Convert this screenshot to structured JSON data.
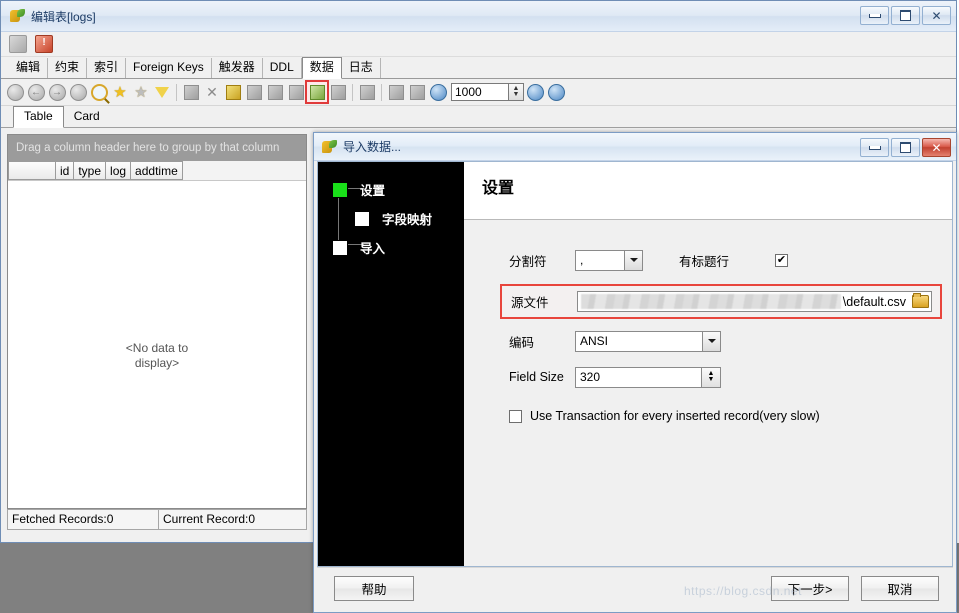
{
  "main_window": {
    "title": "编辑表[logs]",
    "title_icon": "table-edit-icon",
    "window_buttons": {
      "minimize": "minimize-icon",
      "maximize": "maximize-icon",
      "close": "close-icon"
    },
    "mini_toolbar": [
      {
        "name": "save-icon",
        "label": ""
      },
      {
        "name": "stop-icon",
        "label": "!"
      }
    ],
    "tabs": [
      {
        "label": "编辑",
        "active": false
      },
      {
        "label": "约束",
        "active": false
      },
      {
        "label": "索引",
        "active": false
      },
      {
        "label": "Foreign Keys",
        "active": false
      },
      {
        "label": "触发器",
        "active": false
      },
      {
        "label": "DDL",
        "active": false
      },
      {
        "label": "数据",
        "active": true
      },
      {
        "label": "日志",
        "active": false
      }
    ],
    "toolbar": {
      "row_limit_value": "1000",
      "highlighted_button": "import-wizard-icon",
      "icons": [
        "first-record-icon",
        "previous-record-icon",
        "next-record-icon",
        "last-record-icon",
        "find-icon",
        "add-favorite-icon",
        "favorite-icon",
        "filter-icon",
        "copy-icon",
        "delete-icon",
        "add-record-icon",
        "duplicate-record-icon",
        "refresh-record-icon",
        "save-record-icon",
        "import-wizard-icon",
        "stop-icon",
        "export-wizard-icon",
        "print-icon",
        "print-setup-icon",
        "refresh-icon",
        "apply-icon",
        "sync-icon"
      ]
    },
    "subtabs": [
      {
        "label": "Table",
        "active": true
      },
      {
        "label": "Card",
        "active": false
      }
    ],
    "grid": {
      "group_hint": "Drag a column header here to group by that column",
      "columns": [
        "",
        "id",
        "type",
        "log",
        "addtime"
      ],
      "rows": [],
      "empty_message_line1": "<No data to",
      "empty_message_line2": "display>"
    },
    "statusbar": {
      "fetched": "Fetched Records:0",
      "current": "Current Record:0"
    }
  },
  "import_dialog": {
    "title": "导入数据...",
    "title_icon": "import-data-icon",
    "window_buttons": {
      "minimize": "minimize-icon",
      "maximize": "maximize-icon",
      "close": "close-icon"
    },
    "wizard_steps": [
      {
        "label": "设置",
        "active": true
      },
      {
        "label": "字段映射",
        "active": false
      },
      {
        "label": "导入",
        "active": false
      }
    ],
    "panel_title": "设置",
    "form": {
      "delimiter_label": "分割符",
      "delimiter_value": ",",
      "header_row_label": "有标题行",
      "header_row_checked": true,
      "header_row_tick": "✔",
      "source_file_label": "源文件",
      "source_file_visible_value": "\\default.csv",
      "source_file_redacted": true,
      "browse_icon": "folder-open-icon",
      "encoding_label": "编码",
      "encoding_value": "ANSI",
      "field_size_label": "Field Size",
      "field_size_value": "320",
      "transaction_label": "Use Transaction for every inserted record(very slow)",
      "transaction_checked": false
    },
    "footer": {
      "help_label": "帮助",
      "next_label": "下一步>",
      "cancel_label": "取消"
    },
    "highlight_color": "#e8453c"
  },
  "watermark": "https://blog.csdn.net"
}
